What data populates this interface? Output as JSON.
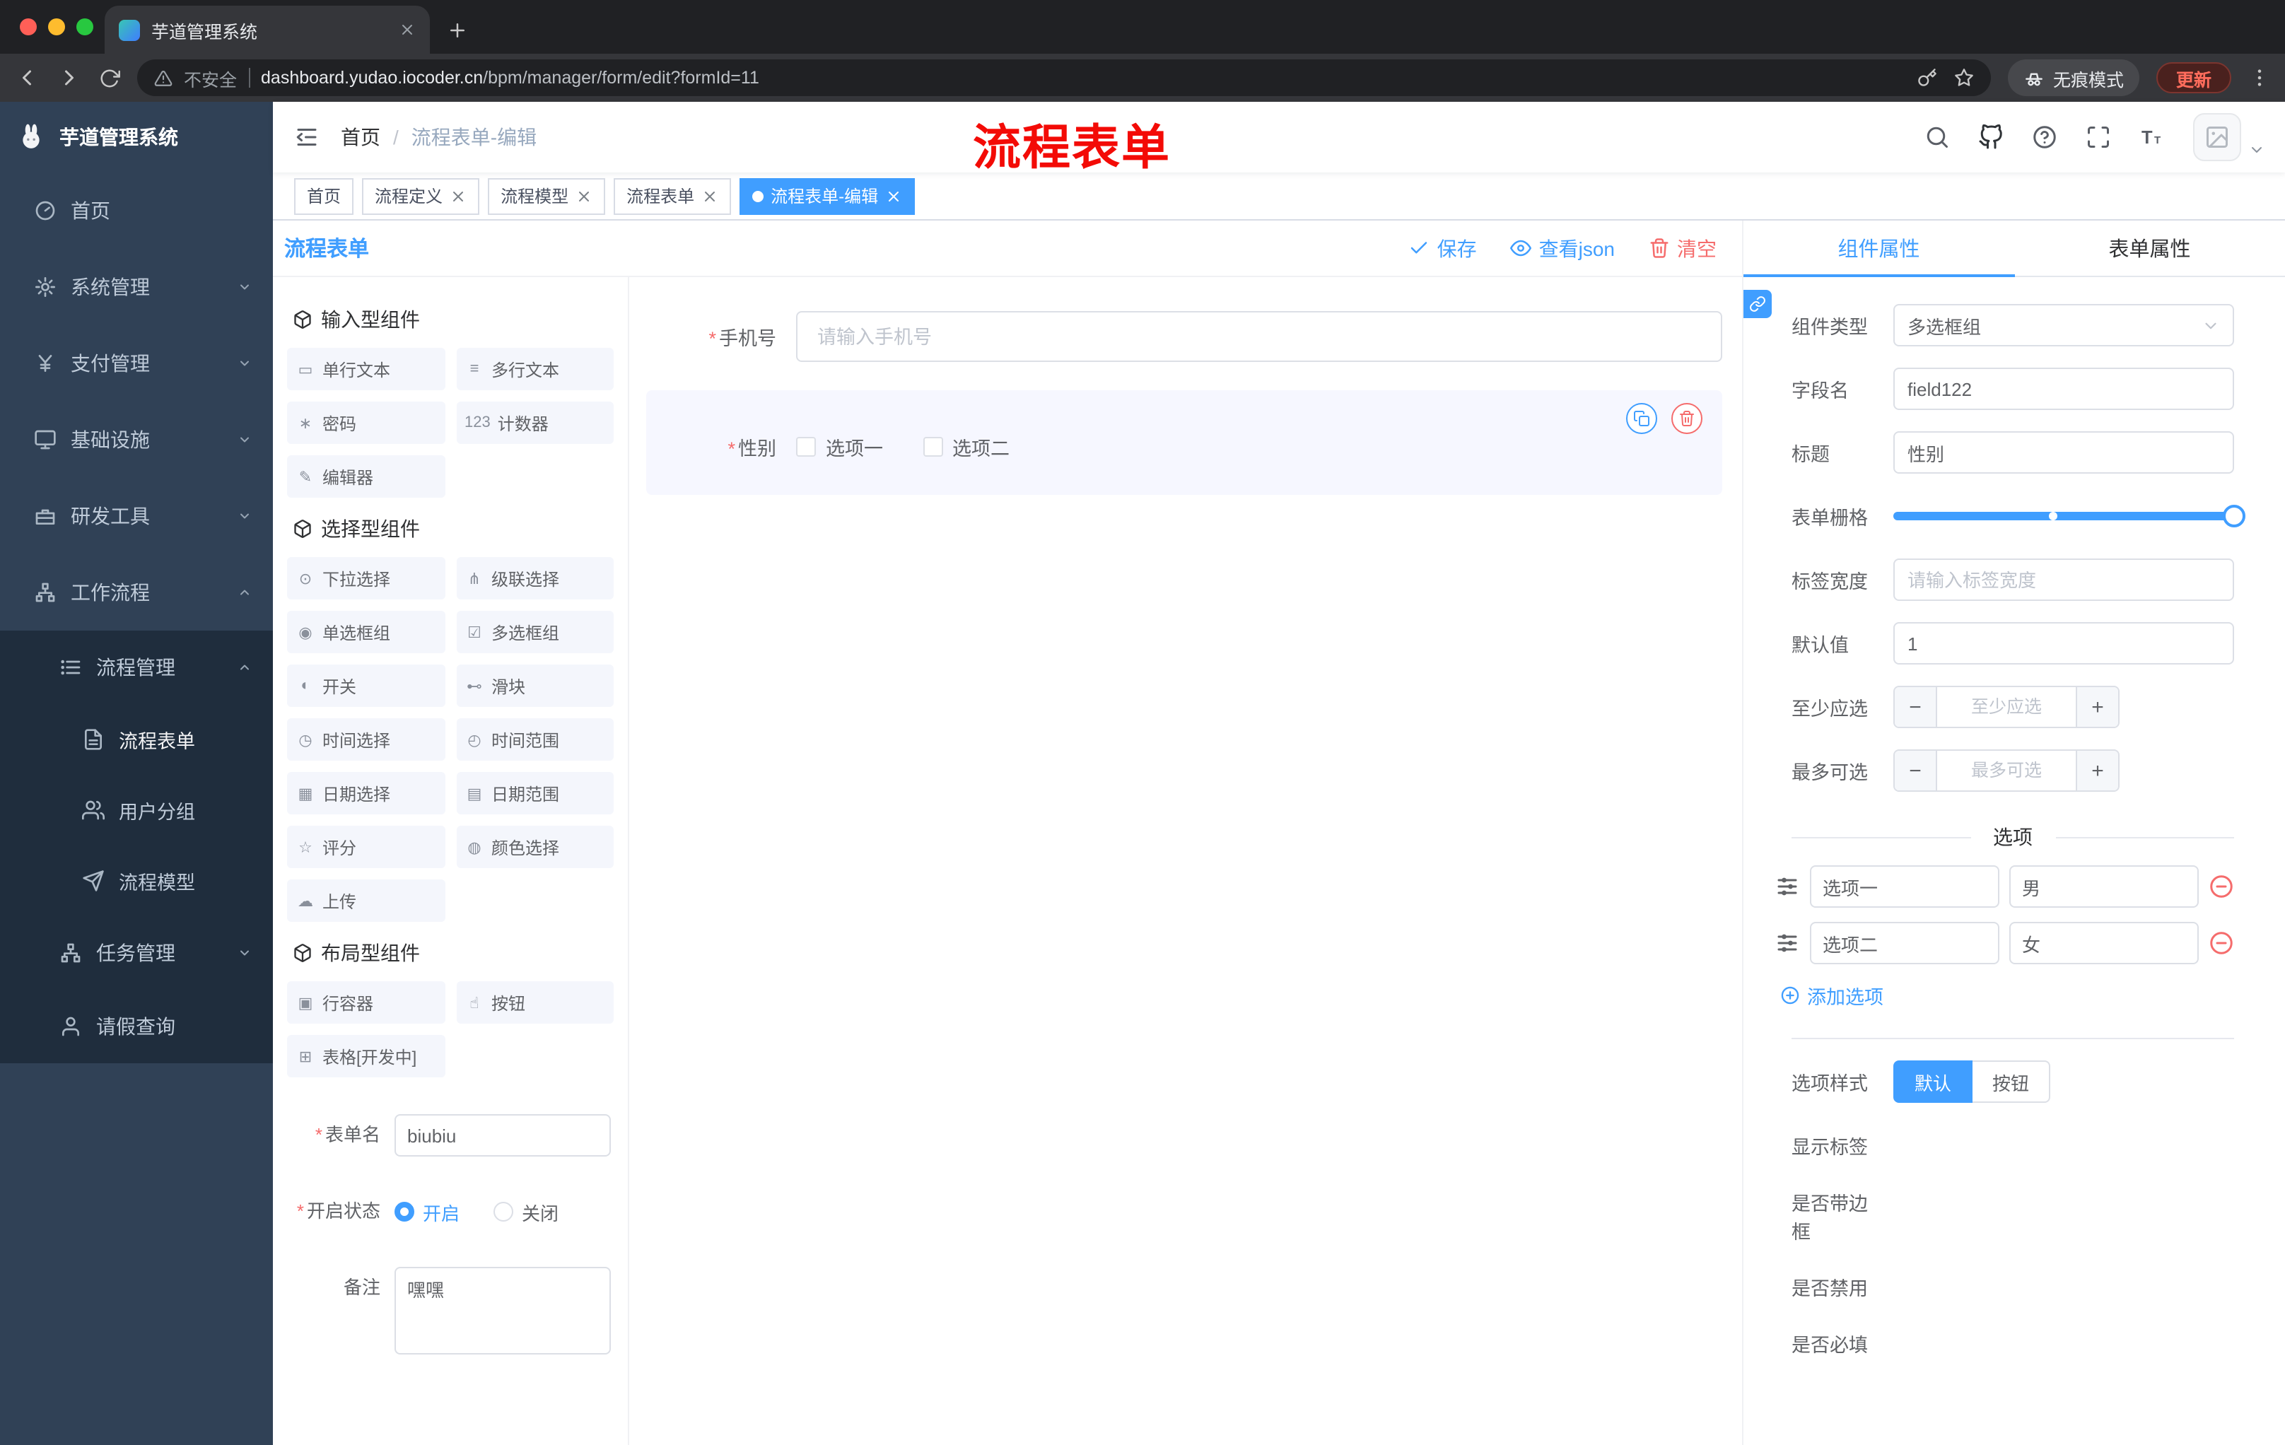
{
  "misc": {
    "required_mark": "*",
    "breadcrumb_sep": "/",
    "minus": "−",
    "plus": "+"
  },
  "colors": {
    "accent": "#409eff",
    "danger": "#f56c6c",
    "annotation_red": "#f30b06",
    "sidebar_bg": "#304156",
    "submenu_bg": "#1f2d3d"
  },
  "browser": {
    "tab_title": "芋道管理系统",
    "security": "不安全",
    "url_domain": "dashboard.yudao.iocoder.cn",
    "url_path": "/bpm/manager/form/edit?formId=11",
    "incognito": "无痕模式",
    "update": "更新"
  },
  "sidebar": {
    "title": "芋道管理系统",
    "items": [
      {
        "label": "首页"
      },
      {
        "label": "系统管理"
      },
      {
        "label": "支付管理"
      },
      {
        "label": "基础设施"
      },
      {
        "label": "研发工具"
      },
      {
        "label": "工作流程"
      },
      {
        "label": "流程管理"
      },
      {
        "label": "流程表单"
      },
      {
        "label": "用户分组"
      },
      {
        "label": "流程模型"
      },
      {
        "label": "任务管理"
      },
      {
        "label": "请假查询"
      }
    ]
  },
  "header": {
    "breadcrumb": [
      "首页",
      "流程表单-编辑"
    ],
    "annotation": "流程表单"
  },
  "tags": [
    {
      "label": "首页",
      "active": false,
      "closable": false
    },
    {
      "label": "流程定义",
      "active": false,
      "closable": true
    },
    {
      "label": "流程模型",
      "active": false,
      "closable": true
    },
    {
      "label": "流程表单",
      "active": false,
      "closable": true
    },
    {
      "label": "流程表单-编辑",
      "active": true,
      "closable": true
    }
  ],
  "designer": {
    "title": "流程表单",
    "actions": {
      "save": "保存",
      "view_json": "查看json",
      "clear": "清空"
    }
  },
  "palette": {
    "sections": [
      {
        "title": "输入型组件",
        "items": [
          {
            "icon": "▭",
            "label": "单行文本"
          },
          {
            "icon": "≡",
            "label": "多行文本"
          },
          {
            "icon": "∗",
            "label": "密码"
          },
          {
            "icon": "123",
            "label": "计数器"
          },
          {
            "icon": "✎",
            "label": "编辑器"
          }
        ]
      },
      {
        "title": "选择型组件",
        "items": [
          {
            "icon": "⊙",
            "label": "下拉选择"
          },
          {
            "icon": "⋔",
            "label": "级联选择"
          },
          {
            "icon": "◉",
            "label": "单选框组"
          },
          {
            "icon": "☑",
            "label": "多选框组"
          },
          {
            "icon": "◐",
            "label": "开关"
          },
          {
            "icon": "⊷",
            "label": "滑块"
          },
          {
            "icon": "◷",
            "label": "时间选择"
          },
          {
            "icon": "◴",
            "label": "时间范围"
          },
          {
            "icon": "▦",
            "label": "日期选择"
          },
          {
            "icon": "▤",
            "label": "日期范围"
          },
          {
            "icon": "☆",
            "label": "评分"
          },
          {
            "icon": "◍",
            "label": "颜色选择"
          },
          {
            "icon": "☁",
            "label": "上传"
          }
        ]
      },
      {
        "title": "布局型组件",
        "items": [
          {
            "icon": "▣",
            "label": "行容器"
          },
          {
            "icon": "☝",
            "label": "按钮"
          },
          {
            "icon": "⊞",
            "label": "表格[开发中]"
          }
        ]
      }
    ],
    "form": {
      "name_label": "表单名",
      "name_value": "biubiu",
      "status_label": "开启状态",
      "status_on": "开启",
      "status_off": "关闭",
      "remark_label": "备注",
      "remark_value": "嘿嘿"
    }
  },
  "canvas": {
    "phone_label": "手机号",
    "phone_placeholder": "请输入手机号",
    "gender_label": "性别",
    "gender_options": [
      "选项一",
      "选项二"
    ]
  },
  "props": {
    "tabs": [
      "组件属性",
      "表单属性"
    ],
    "component_type_label": "组件类型",
    "component_type_value": "多选框组",
    "field_label": "字段名",
    "field_value": "field122",
    "title_label": "标题",
    "title_value": "性别",
    "grid_label": "表单栅格",
    "label_width_label": "标签宽度",
    "label_width_placeholder": "请输入标签宽度",
    "default_label": "默认值",
    "default_value": "1",
    "min_label": "至少应选",
    "min_placeholder": "至少应选",
    "max_label": "最多可选",
    "max_placeholder": "最多可选",
    "options_divider": "选项",
    "options": [
      {
        "label": "选项一",
        "value": "男"
      },
      {
        "label": "选项二",
        "value": "女"
      }
    ],
    "add_option": "添加选项",
    "style_label": "选项样式",
    "style_options": [
      "默认",
      "按钮"
    ],
    "switches": [
      {
        "label": "显示标签",
        "on": true
      },
      {
        "label": "是否带边框",
        "on": false
      },
      {
        "label": "是否禁用",
        "on": false
      },
      {
        "label": "是否必填",
        "on": true
      }
    ]
  }
}
